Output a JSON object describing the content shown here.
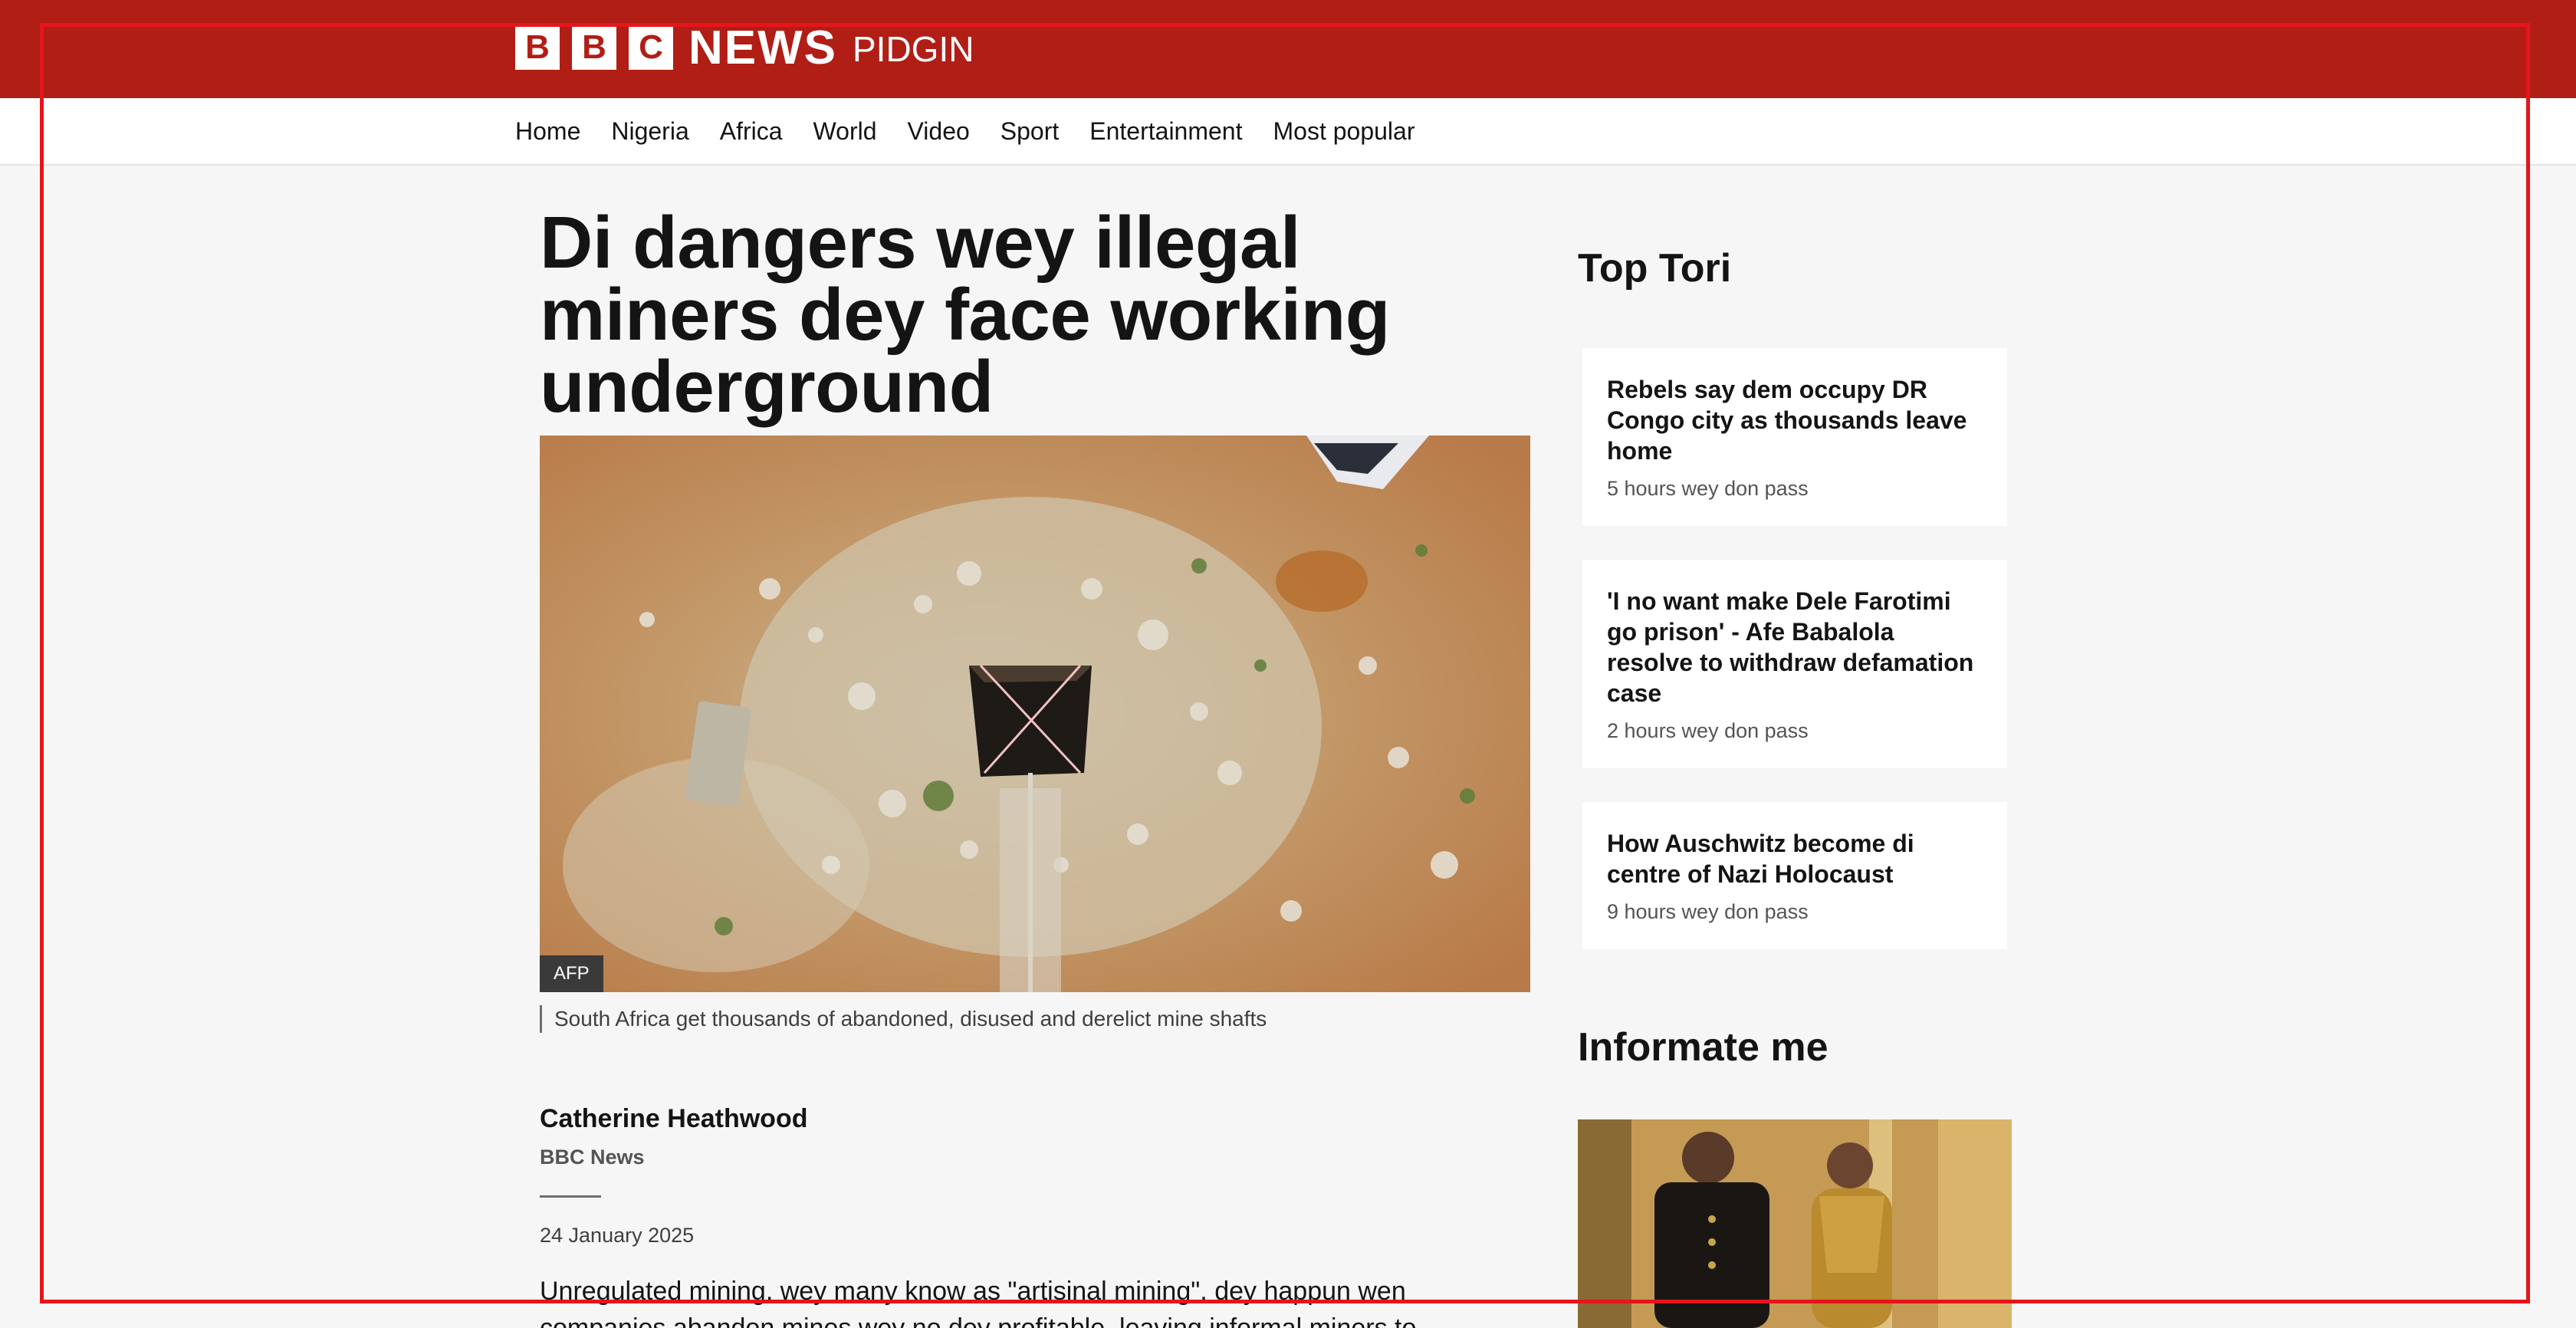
{
  "brand": {
    "letters": [
      "B",
      "B",
      "C"
    ],
    "news": "NEWS",
    "edition": "PIDGIN",
    "colors": {
      "header_red": "#b01e16",
      "page_bg": "#f6f6f6",
      "annotation_red": "#e8141b"
    }
  },
  "nav": {
    "items": [
      {
        "label": "Home"
      },
      {
        "label": "Nigeria"
      },
      {
        "label": "Africa"
      },
      {
        "label": "World"
      },
      {
        "label": "Video"
      },
      {
        "label": "Sport"
      },
      {
        "label": "Entertainment"
      },
      {
        "label": "Most popular"
      }
    ]
  },
  "article": {
    "headline": "Di dangers wey illegal miners dey face working underground",
    "image": {
      "credit": "AFP",
      "caption": "South Africa get thousands of abandoned, disused and derelict mine shafts"
    },
    "author": "Catherine Heathwood",
    "organisation": "BBC News",
    "date": "24 January 2025",
    "body": "Unregulated mining, wey many know as \"artisinal mining\", dey happun wen companies abandon mines wey no dey profitable, leaving informal miners to extract"
  },
  "sidebar": {
    "top_title": "Top Tori",
    "stories": [
      {
        "title": "Rebels say dem occupy DR Congo city as thousands leave home",
        "time": "5 hours wey don pass"
      },
      {
        "title": "'I no want make Dele Farotimi go prison' - Afe Babalola resolve to withdraw defamation case",
        "time": "2 hours wey don pass"
      },
      {
        "title": "How Auschwitz become di centre of Nazi Holocaust",
        "time": "9 hours wey don pass"
      }
    ],
    "info_title": "Informate me"
  }
}
